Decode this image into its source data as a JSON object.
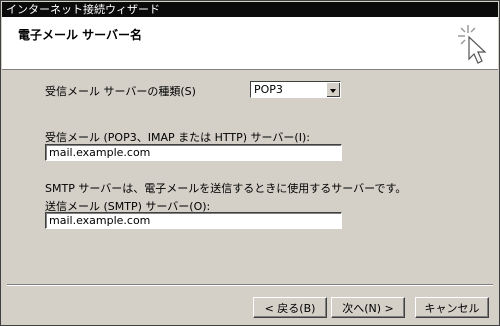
{
  "window": {
    "title": "インターネット接続ウィザード",
    "header_title": "電子メール サーバー名"
  },
  "form": {
    "server_type_label": "受信メール サーバーの種類(S)",
    "server_type_value": "POP3",
    "incoming_label": "受信メール (POP3、IMAP または HTTP) サーバー(I):",
    "incoming_value": "mail.example.com",
    "smtp_description": "SMTP サーバーは、電子メールを送信するときに使用するサーバーです。",
    "outgoing_label": "送信メール (SMTP) サーバー(O):",
    "outgoing_value": "mail.example.com"
  },
  "buttons": {
    "back": "< 戻る(B)",
    "next": "次へ(N) >",
    "cancel": "キャンセル"
  },
  "icons": {
    "wizard": "cursor-sparkle-icon",
    "dropdown": "chevron-down-icon"
  }
}
